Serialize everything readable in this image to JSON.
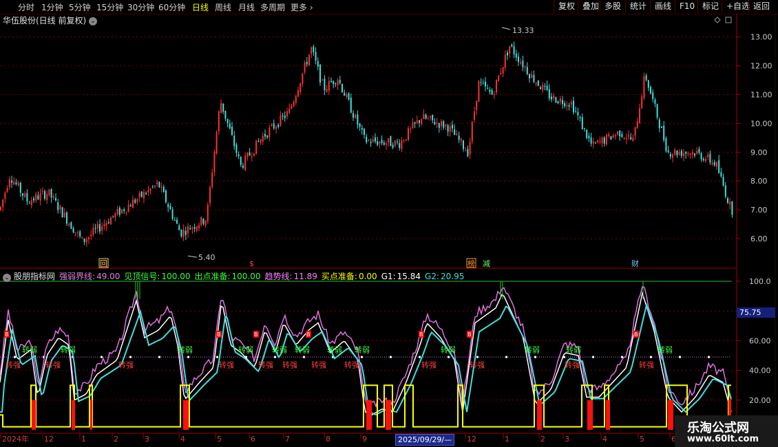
{
  "toolbar": {
    "periods": [
      "分时",
      "1分钟",
      "5分钟",
      "15分钟",
      "30分钟",
      "60分钟",
      "日线",
      "周线",
      "月线",
      "多周期",
      "更多"
    ],
    "active_period": "日线",
    "more_arrow": "›",
    "right_buttons": [
      "复权",
      "叠加",
      "多股",
      "统计",
      "画线",
      "F10",
      "标记",
      "+自选",
      "返回"
    ]
  },
  "stock": {
    "title": "华伍股份(日线 前复权)",
    "price_ticks": [
      "13.00",
      "12.00",
      "11.00",
      "10.00",
      "9.00",
      "8.00",
      "7.00",
      "6.00"
    ],
    "high_label": "13.33",
    "low_label": "5.40",
    "event_markers": [
      "回",
      "$",
      "榜",
      "减",
      "财"
    ]
  },
  "indicator": {
    "name": "股朋指标网",
    "items": [
      {
        "label": "强弱界线:",
        "value": "49.00",
        "color": "#e080e0"
      },
      {
        "label": "见顶信号:",
        "value": "100.00",
        "color": "#40ff40"
      },
      {
        "label": "出点准备:",
        "value": "100.00",
        "color": "#40ff40"
      },
      {
        "label": "趋势线:",
        "value": "11.89",
        "color": "#ff80ff"
      },
      {
        "label": "买点准备:",
        "value": "0.00",
        "color": "#ffff00"
      },
      {
        "label": "G1:",
        "value": "15.84",
        "color": "#ffffff"
      },
      {
        "label": "G2:",
        "value": "20.95",
        "color": "#40e0e0"
      }
    ],
    "ticks": [
      "100.0",
      "80.00",
      "60.00",
      "40.00",
      "20.00"
    ],
    "current_value": "75.75",
    "weak_text": "转弱",
    "strong_text": "转强",
    "buy_mark": "B"
  },
  "timeline": {
    "labels": [
      "2024年",
      "12",
      "1",
      "2",
      "3",
      "4",
      "5",
      "6",
      "7",
      "8",
      "9",
      "12",
      "1",
      "2",
      "3",
      "4",
      "5",
      "6"
    ],
    "cursor_date": "2025/09/29/—"
  },
  "watermark": {
    "name": "乐淘公式网",
    "url": "www.60lt.com"
  },
  "colors": {
    "up": "#ff3030",
    "down": "#40e0e0",
    "grid": "#8a0000",
    "border": "#a00000"
  }
}
